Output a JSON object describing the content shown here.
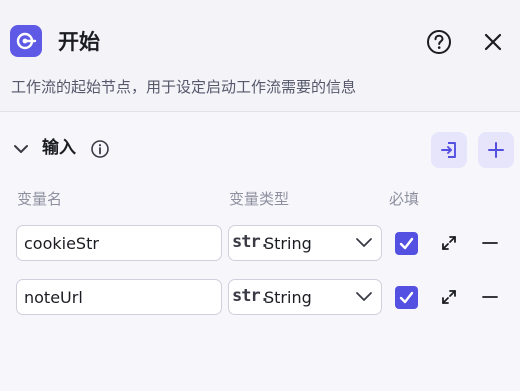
{
  "header": {
    "title": "开始",
    "description": "工作流的起始节点，用于设定启动工作流需要的信息",
    "node_icon": "start-node-icon",
    "help_icon": "question-circle-icon",
    "close_icon": "close-icon"
  },
  "input_section": {
    "title": "输入",
    "info_icon": "info-circle-icon",
    "collapse_icon": "chevron-down-icon",
    "import_icon": "import-icon",
    "add_icon": "plus-icon",
    "columns": {
      "name": "变量名",
      "type": "变量类型",
      "required": "必填"
    },
    "rows": [
      {
        "name": "cookieStr",
        "type_prefix": "str.",
        "type": "String",
        "required": true
      },
      {
        "name": "noteUrl",
        "type_prefix": "str.",
        "type": "String",
        "required": true
      }
    ]
  },
  "colors": {
    "accent": "#5450e2",
    "accent_light": "#e6e5fb",
    "background": "#f7f7fb",
    "muted_text": "#8e90a0"
  }
}
